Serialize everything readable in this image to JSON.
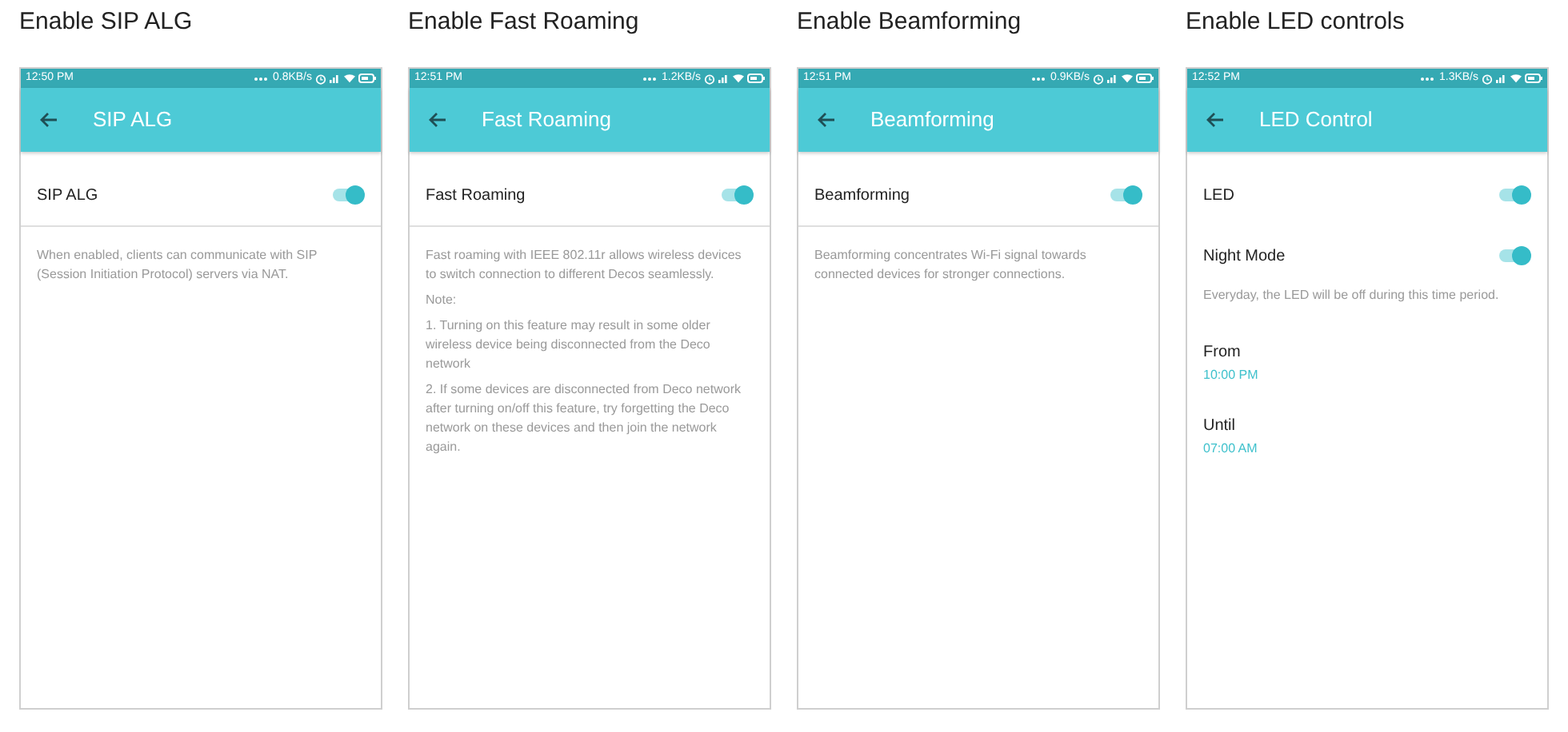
{
  "panels": [
    {
      "heading": "Enable SIP ALG",
      "status": {
        "time": "12:50  PM",
        "speed": "0.8KB/s"
      },
      "title": "SIP ALG",
      "items": [
        {
          "kind": "toggle",
          "label": "SIP ALG",
          "on": true
        },
        {
          "kind": "divider"
        },
        {
          "kind": "note",
          "text": "When enabled, clients can communicate with SIP (Session Initiation Protocol) servers via NAT."
        }
      ]
    },
    {
      "heading": "Enable Fast Roaming",
      "status": {
        "time": "12:51  PM",
        "speed": "1.2KB/s"
      },
      "title": "Fast Roaming",
      "items": [
        {
          "kind": "toggle",
          "label": "Fast Roaming",
          "on": true
        },
        {
          "kind": "divider"
        },
        {
          "kind": "note",
          "text": "Fast roaming with IEEE 802.11r allows wireless devices to switch connection to different Decos seamlessly."
        },
        {
          "kind": "note",
          "text": "Note:"
        },
        {
          "kind": "note",
          "text": "1. Turning on this feature may result in some older wireless device being disconnected from the Deco network"
        },
        {
          "kind": "note",
          "text": "2. If some devices are disconnected from Deco network after turning on/off this feature, try forgetting the Deco network on these devices and then join the network again."
        }
      ]
    },
    {
      "heading": "Enable Beamforming",
      "status": {
        "time": "12:51  PM",
        "speed": "0.9KB/s"
      },
      "title": "Beamforming",
      "items": [
        {
          "kind": "toggle",
          "label": "Beamforming",
          "on": true
        },
        {
          "kind": "divider"
        },
        {
          "kind": "note",
          "text": "Beamforming concentrates Wi-Fi signal towards connected devices for stronger connections."
        }
      ]
    },
    {
      "heading": "Enable LED controls",
      "status": {
        "time": "12:52  PM",
        "speed": "1.3KB/s"
      },
      "title": "LED Control",
      "items": [
        {
          "kind": "toggle",
          "label": "LED",
          "on": true
        },
        {
          "kind": "toggle",
          "label": "Night Mode",
          "on": true
        },
        {
          "kind": "note",
          "text": "Everyday, the LED will be off during this time period."
        },
        {
          "kind": "time",
          "label": "From",
          "value": "10:00 PM"
        },
        {
          "kind": "time",
          "label": "Until",
          "value": "07:00 AM"
        }
      ]
    }
  ]
}
